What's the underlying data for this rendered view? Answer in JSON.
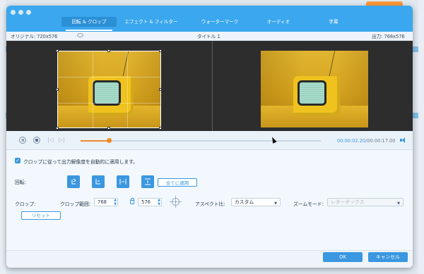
{
  "dialog": {
    "tabs": [
      {
        "label": "回転 & クロップ",
        "active": true
      },
      {
        "label": "エフェクト & フィルター",
        "active": false
      },
      {
        "label": "ウォーターマーク",
        "active": false
      },
      {
        "label": "オーディオ",
        "active": false
      },
      {
        "label": "字幕",
        "active": false
      }
    ],
    "original_label": "オリジナル: 720x576",
    "title": "タイトル 1",
    "output_label": "出力: 768x576"
  },
  "playback": {
    "progress_fraction": 0.12,
    "current_time": "00:00:02.20",
    "total_time": "/00:00:17.00"
  },
  "options": {
    "auto_apply_checked": true,
    "auto_apply_label": "クロップに従って出力解像度を自動的に適用します。",
    "rotate_label": "回転:",
    "rotate_buttons": [
      {
        "icon": "rotate-left-icon"
      },
      {
        "icon": "rotate-right-icon"
      },
      {
        "icon": "flip-horizontal-icon"
      },
      {
        "icon": "flip-vertical-icon"
      }
    ],
    "apply_all_label": "全てに適用",
    "crop_label": "クロップ:",
    "crop_area_label": "クロップ範囲:",
    "crop_width": "768",
    "crop_height": "576",
    "aspect_label": "アスペクト比:",
    "aspect_value": "カスタム",
    "zoom_label": "ズームモード:",
    "zoom_value": "レターボックス",
    "reset_label": "リセット"
  },
  "footer": {
    "ok_label": "OK",
    "cancel_label": "キャンセル"
  },
  "colors": {
    "accent": "#3a97e0",
    "tabbar": "#3aa7ee",
    "progress": "#f08a2a"
  }
}
